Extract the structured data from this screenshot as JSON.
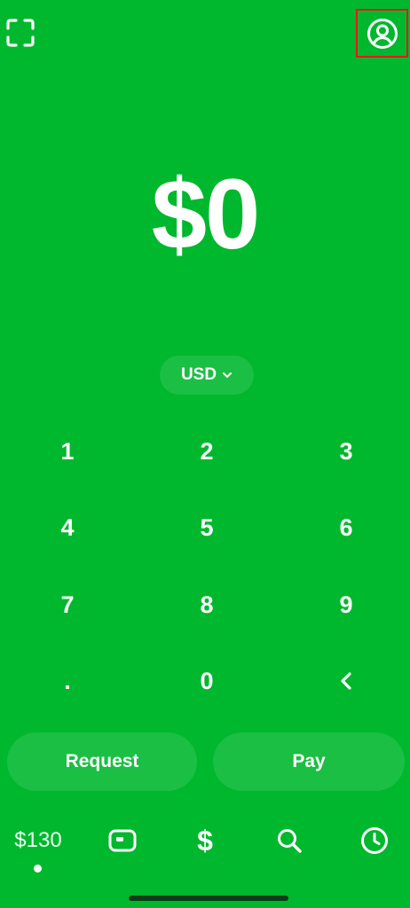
{
  "amount": "$0",
  "currency": {
    "label": "USD",
    "icon": "chevron-down-icon"
  },
  "top_bar": {
    "left_icon": "scan-icon",
    "right_icon": "profile-icon"
  },
  "keypad": {
    "keys": [
      "1",
      "2",
      "3",
      "4",
      "5",
      "6",
      "7",
      "8",
      "9",
      ".",
      "0"
    ],
    "backspace_icon": "chevron-left-icon"
  },
  "actions": {
    "request_label": "Request",
    "pay_label": "Pay"
  },
  "nav": {
    "balance_label": "$130",
    "dollar_label": "$",
    "icons": [
      "card-icon",
      "dollar-icon",
      "search-icon",
      "clock-icon"
    ],
    "active_tab": "balance"
  },
  "colors": {
    "background": "#00B82E",
    "text": "#FFFFFF",
    "highlight_border": "#E11B1B"
  }
}
